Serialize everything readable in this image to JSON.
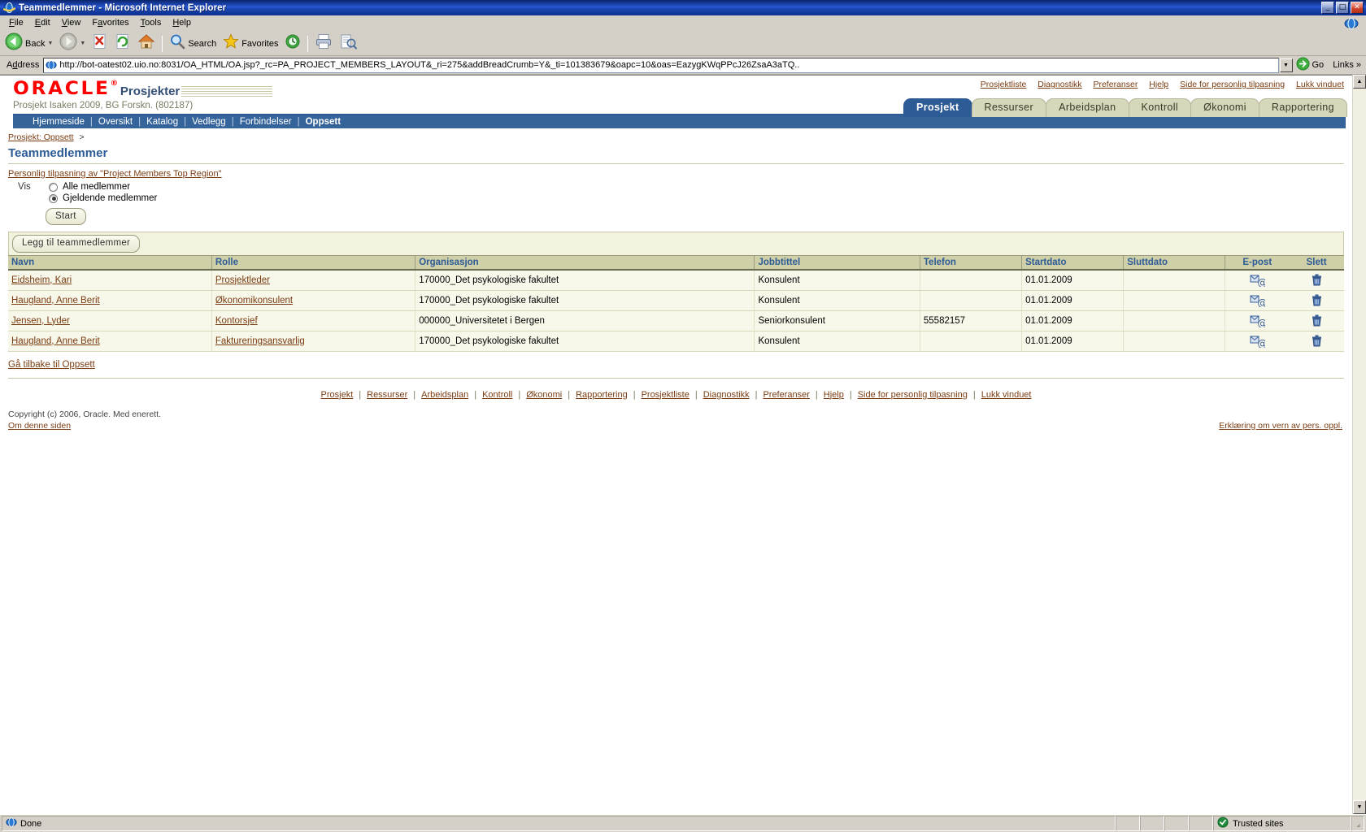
{
  "window": {
    "title": "Teammedlemmer - Microsoft Internet Explorer",
    "minimize_label": "_",
    "maximize_label": "□",
    "close_label": "✕"
  },
  "menu": [
    {
      "label": "File",
      "accel": "F"
    },
    {
      "label": "Edit",
      "accel": "E"
    },
    {
      "label": "View",
      "accel": "V"
    },
    {
      "label": "Favorites",
      "accel": "a"
    },
    {
      "label": "Tools",
      "accel": "T"
    },
    {
      "label": "Help",
      "accel": "H"
    }
  ],
  "toolbar": {
    "back_label": "Back",
    "search_label": "Search",
    "favorites_label": "Favorites"
  },
  "address": {
    "label": "Address",
    "url": "http://bot-oatest02.uio.no:8031/OA_HTML/OA.jsp?_rc=PA_PROJECT_MEMBERS_LAYOUT&_ri=275&addBreadCrumb=Y&_ti=101383679&oapc=10&oas=EazygKWqPPcJ26ZsaA3aTQ..",
    "go_label": "Go",
    "links_label": "Links"
  },
  "brand": {
    "logo_text": "ORACLE",
    "trademark": "®",
    "app_name": "Prosjekter"
  },
  "project": {
    "subtitle": "Prosjekt Isaken 2009, BG Forskn. (802187)"
  },
  "global_links": [
    {
      "label": "Prosjektliste"
    },
    {
      "label": "Diagnostikk"
    },
    {
      "label": "Preferanser"
    },
    {
      "label": "Hjelp"
    },
    {
      "label": "Side for personlig tilpasning"
    },
    {
      "label": "Lukk vinduet"
    }
  ],
  "tabs": [
    {
      "label": "Prosjekt",
      "active": true
    },
    {
      "label": "Ressurser",
      "active": false
    },
    {
      "label": "Arbeidsplan",
      "active": false
    },
    {
      "label": "Kontroll",
      "active": false
    },
    {
      "label": "Økonomi",
      "active": false
    },
    {
      "label": "Rapportering",
      "active": false
    }
  ],
  "subnav": [
    {
      "label": "Hjemmeside",
      "current": false
    },
    {
      "label": "Oversikt",
      "current": false
    },
    {
      "label": "Katalog",
      "current": false
    },
    {
      "label": "Vedlegg",
      "current": false
    },
    {
      "label": "Forbindelser",
      "current": false
    },
    {
      "label": "Oppsett",
      "current": true
    }
  ],
  "breadcrumb": {
    "link": "Prosjekt: Oppsett",
    "separator": ">"
  },
  "page_title": "Teammedlemmer",
  "personalize_link": "Personlig tilpasning av \"Project Members Top Region\"",
  "show": {
    "label": "Vis",
    "options": [
      {
        "label": "Alle medlemmer",
        "selected": false
      },
      {
        "label": "Gjeldende medlemmer",
        "selected": true
      }
    ],
    "start_button": "Start"
  },
  "table_toolbar": {
    "add_button": "Legg til teammedlemmer"
  },
  "table": {
    "columns": [
      "Navn",
      "Rolle",
      "Organisasjon",
      "Jobbtittel",
      "Telefon",
      "Startdato",
      "Sluttdato",
      "E-post",
      "Slett"
    ],
    "rows": [
      {
        "navn": "Eidsheim, Kari",
        "rolle": "Prosjektleder",
        "organisasjon": "170000_Det psykologiske fakultet",
        "jobbtittel": "Konsulent",
        "telefon": "",
        "startdato": "01.01.2009",
        "sluttdato": "",
        "epost_icon": "mail-icon",
        "slett_icon": "trash-icon"
      },
      {
        "navn": "Haugland, Anne Berit",
        "rolle": "Økonomikonsulent",
        "organisasjon": "170000_Det psykologiske fakultet",
        "jobbtittel": "Konsulent",
        "telefon": "",
        "startdato": "01.01.2009",
        "sluttdato": "",
        "epost_icon": "mail-icon",
        "slett_icon": "trash-icon"
      },
      {
        "navn": "Jensen, Lyder",
        "rolle": "Kontorsjef",
        "organisasjon": "000000_Universitetet i Bergen",
        "jobbtittel": "Seniorkonsulent",
        "telefon": "55582157",
        "startdato": "01.01.2009",
        "sluttdato": "",
        "epost_icon": "mail-icon",
        "slett_icon": "trash-icon"
      },
      {
        "navn": "Haugland, Anne Berit",
        "rolle": "Faktureringsansvarlig",
        "organisasjon": "170000_Det psykologiske fakultet",
        "jobbtittel": "Konsulent",
        "telefon": "",
        "startdato": "01.01.2009",
        "sluttdato": "",
        "epost_icon": "mail-icon",
        "slett_icon": "trash-icon"
      }
    ]
  },
  "back_link": "Gå tilbake til Oppsett",
  "footer_links": [
    {
      "label": "Prosjekt"
    },
    {
      "label": "Ressurser"
    },
    {
      "label": "Arbeidsplan"
    },
    {
      "label": "Kontroll"
    },
    {
      "label": "Økonomi"
    },
    {
      "label": "Rapportering"
    },
    {
      "label": "Prosjektliste"
    },
    {
      "label": "Diagnostikk"
    },
    {
      "label": "Preferanser"
    },
    {
      "label": "Hjelp"
    },
    {
      "label": "Side for personlig tilpasning"
    },
    {
      "label": "Lukk vinduet"
    }
  ],
  "copyright": "Copyright (c) 2006, Oracle. Med enerett.",
  "about_link": "Om denne siden",
  "privacy_link": "Erklæring om vern av pers. oppl.",
  "statusbar": {
    "status": "Done",
    "zone": "Trusted sites"
  },
  "colors": {
    "titlebar": "#0a246a",
    "oracle_red": "#ff0000",
    "tab_active": "#2c5b96",
    "tab_inactive": "#d7d7bc",
    "link": "#7a3c12",
    "header_text": "#2c5b96",
    "table_header_bg": "#cfcfa8",
    "table_row_bg": "#f7f7ea"
  }
}
